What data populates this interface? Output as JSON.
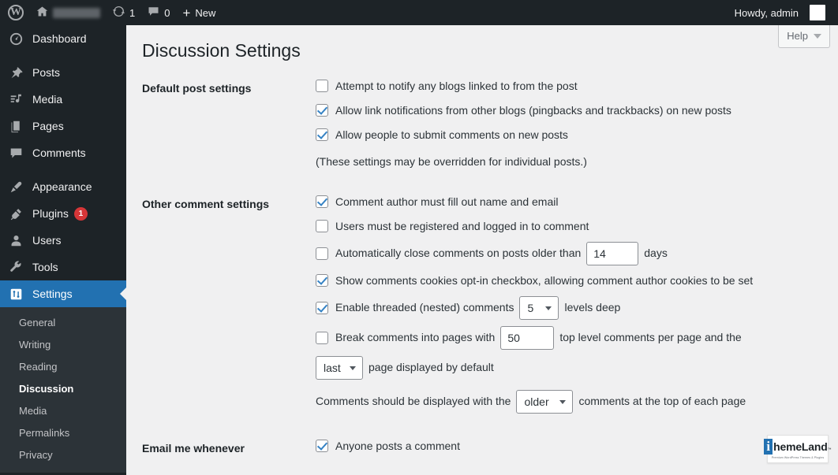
{
  "adminbar": {
    "wp_logo": "W",
    "site_name_redacted": "",
    "updates_count": "1",
    "comments_count": "0",
    "new_label": "New",
    "howdy": "Howdy, admin"
  },
  "sidebar": {
    "menu": [
      {
        "label": "Dashboard",
        "icon": "dashboard-icon",
        "badge": null
      },
      {
        "label": "Posts",
        "icon": "pin-icon",
        "badge": null
      },
      {
        "label": "Media",
        "icon": "media-icon",
        "badge": null
      },
      {
        "label": "Pages",
        "icon": "pages-icon",
        "badge": null
      },
      {
        "label": "Comments",
        "icon": "comments-icon",
        "badge": null
      },
      {
        "label": "Appearance",
        "icon": "brush-icon",
        "badge": null
      },
      {
        "label": "Plugins",
        "icon": "plug-icon",
        "badge": "1"
      },
      {
        "label": "Users",
        "icon": "user-icon",
        "badge": null
      },
      {
        "label": "Tools",
        "icon": "wrench-icon",
        "badge": null
      },
      {
        "label": "Settings",
        "icon": "settings-icon",
        "badge": null
      }
    ],
    "submenu": [
      {
        "label": "General",
        "current": false
      },
      {
        "label": "Writing",
        "current": false
      },
      {
        "label": "Reading",
        "current": false
      },
      {
        "label": "Discussion",
        "current": true
      },
      {
        "label": "Media",
        "current": false
      },
      {
        "label": "Permalinks",
        "current": false
      },
      {
        "label": "Privacy",
        "current": false
      }
    ]
  },
  "content": {
    "help_label": "Help",
    "page_title": "Discussion Settings"
  },
  "default_post_settings": {
    "label": "Default post settings",
    "opt_notify_blogs": "Attempt to notify any blogs linked to from the post",
    "opt_link_notifications": "Allow link notifications from other blogs (pingbacks and trackbacks) on new posts",
    "opt_allow_comments": "Allow people to submit comments on new posts",
    "note": "(These settings may be overridden for individual posts.)"
  },
  "other_comment_settings": {
    "label": "Other comment settings",
    "opt_name_email": "Comment author must fill out name and email",
    "opt_registered": "Users must be registered and logged in to comment",
    "opt_autoclose_pre": "Automatically close comments on posts older than",
    "autoclose_days_value": "14",
    "opt_autoclose_post": "days",
    "opt_cookies": "Show comments cookies opt-in checkbox, allowing comment author cookies to be set",
    "opt_threaded_pre": "Enable threaded (nested) comments",
    "threaded_levels_value": "5",
    "opt_threaded_post": "levels deep",
    "opt_break_pages_pre": "Break comments into pages with",
    "comments_per_page_value": "50",
    "opt_break_pages_post": "top level comments per page and the",
    "page_default_value": "last",
    "opt_page_displayed": "page displayed by default",
    "opt_display_order_pre": "Comments should be displayed with the",
    "display_order_value": "older",
    "opt_display_order_post": "comments at the top of each page"
  },
  "email_me": {
    "label": "Email me whenever",
    "opt_anyone_posts": "Anyone posts a comment"
  },
  "themeland": {
    "logo_i": "i",
    "logo_rest": "hemeLand",
    "trademark": "™",
    "tagline": "Premium WordPress Themes & Plugins"
  }
}
